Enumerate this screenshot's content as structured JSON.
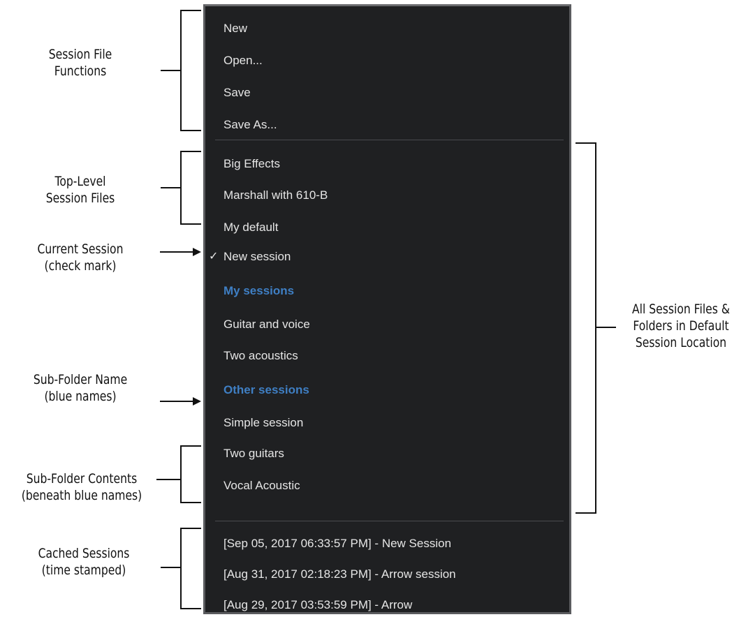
{
  "menu": {
    "file_functions": [
      "New",
      "Open...",
      "Save",
      "Save As..."
    ],
    "top_level_sessions": [
      "Big Effects",
      "Marshall with 610-B",
      "My default"
    ],
    "current_session": "New session",
    "checkmark": "✓",
    "folders": [
      {
        "name": "My sessions",
        "items": [
          "Guitar and voice",
          "Two acoustics"
        ]
      },
      {
        "name": "Other sessions",
        "items": [
          "Simple session",
          "Two guitars",
          "Vocal Acoustic"
        ]
      }
    ],
    "cached_sessions": [
      "[Sep 05, 2017 06:33:57 PM] - New Session",
      "[Aug 31, 2017 02:18:23 PM] - Arrow session",
      "[Aug 29, 2017 03:53:59 PM] - Arrow"
    ]
  },
  "annotations": {
    "session_file_functions": [
      "Session File",
      "Functions"
    ],
    "top_level_session_files": [
      "Top-Level",
      "Session Files"
    ],
    "current_session": [
      "Current Session",
      "(check mark)"
    ],
    "sub_folder_name": [
      "Sub-Folder Name",
      "(blue names)"
    ],
    "sub_folder_contents": [
      "Sub-Folder Contents",
      "(beneath blue names)"
    ],
    "cached_sessions": [
      "Cached Sessions",
      "(time stamped)"
    ],
    "all_session_files": [
      "All Session Files &",
      "Folders in Default",
      "Session Location"
    ]
  },
  "colors": {
    "menu_background": "#1f2022",
    "menu_text": "#e6e6e6",
    "folder_blue": "#3f7fc4"
  }
}
